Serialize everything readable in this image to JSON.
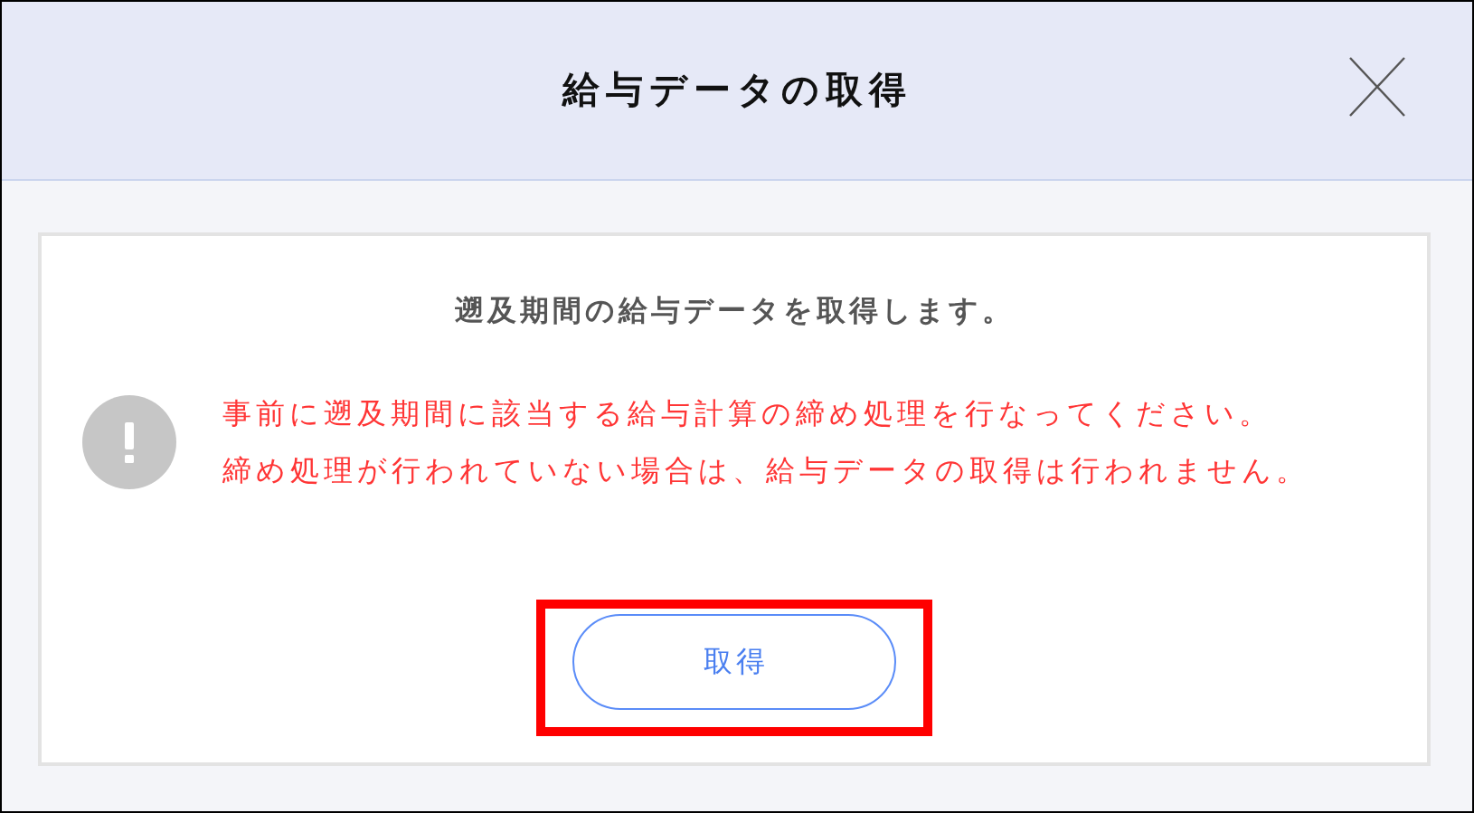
{
  "dialog": {
    "title": "給与データの取得"
  },
  "message": "遡及期間の給与データを取得します。",
  "warning": {
    "lines": [
      "事前に遡及期間に該当する給与計算の締め処理を行なってください。",
      "締め処理が行われていない場合は、給与データの取得は行われません。"
    ]
  },
  "button": {
    "label": "取得",
    "highlighted": true
  }
}
